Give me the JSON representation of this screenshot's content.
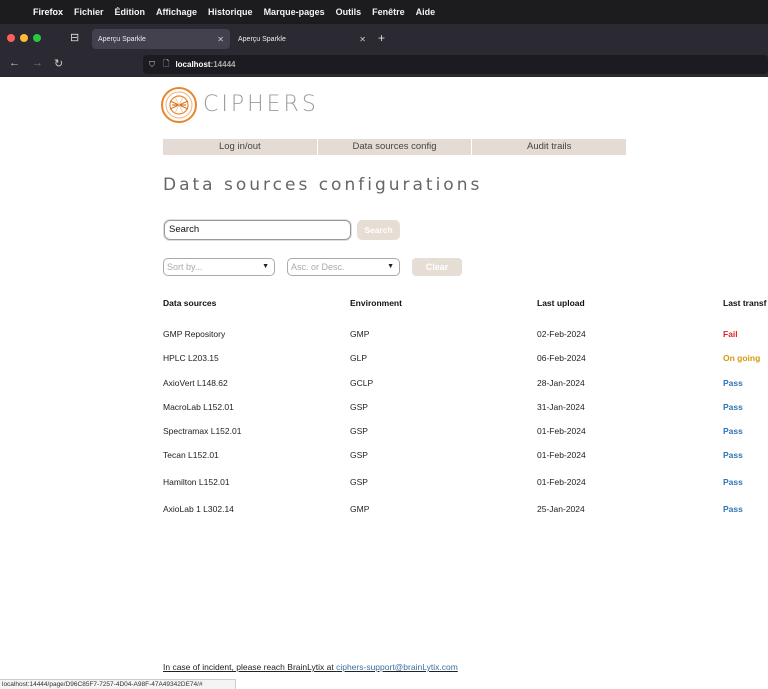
{
  "menubar": {
    "items": [
      "Firefox",
      "Fichier",
      "Édition",
      "Affichage",
      "Historique",
      "Marque-pages",
      "Outils",
      "Fenêtre",
      "Aide"
    ]
  },
  "browser": {
    "tabs": [
      {
        "label": "Aperçu Sparkle",
        "active": true
      },
      {
        "label": "Aperçu Sparkle",
        "active": false
      }
    ],
    "url_host": "localhost",
    "url_port": ":14444",
    "status_url": "localhost:14444/page/D96C85F7-7257-4D04-A98F-47A49342DE74/#"
  },
  "app": {
    "brand": "CIPHERS",
    "nav": [
      "Log in/out",
      "Data sources config",
      "Audit trails"
    ],
    "title": "Data sources configurations",
    "search": {
      "value": "Search",
      "button": "Search"
    },
    "sort_placeholder": "Sort by...",
    "order_placeholder": "Asc. or Desc.",
    "clear_label": "Clear",
    "table": {
      "headers": [
        "Data sources",
        "Environment",
        "Last upload",
        "Last transf"
      ],
      "rows": [
        {
          "source": "GMP Repository",
          "env": "GMP",
          "upload": "02-Feb-2024",
          "status": "Fail"
        },
        {
          "source": "HPLC L203.15",
          "env": "GLP",
          "upload": "06-Feb-2024",
          "status": "On going"
        },
        {
          "source": "AxioVert L148.62",
          "env": "GCLP",
          "upload": "28-Jan-2024",
          "status": "Pass"
        },
        {
          "source": "MacroLab L152.01",
          "env": "GSP",
          "upload": "31-Jan-2024",
          "status": "Pass"
        },
        {
          "source": "Spectramax L152.01",
          "env": "GSP",
          "upload": "01-Feb-2024",
          "status": "Pass"
        },
        {
          "source": "Tecan L152.01",
          "env": "GSP",
          "upload": "01-Feb-2024",
          "status": "Pass"
        },
        {
          "source": "Hamilton L152.01",
          "env": "GSP",
          "upload": "01-Feb-2024",
          "status": "Pass"
        },
        {
          "source": "AxioLab 1 L302.14",
          "env": "GMP",
          "upload": "25-Jan-2024",
          "status": "Pass"
        }
      ]
    },
    "status_colors": {
      "Fail": "#e0242a",
      "On going": "#d49a0c",
      "Pass": "#2f76b8"
    },
    "footer": {
      "text": "In case of incident, please reach BrainLytix at ",
      "email": "ciphers-support@brainLytix.com"
    }
  }
}
